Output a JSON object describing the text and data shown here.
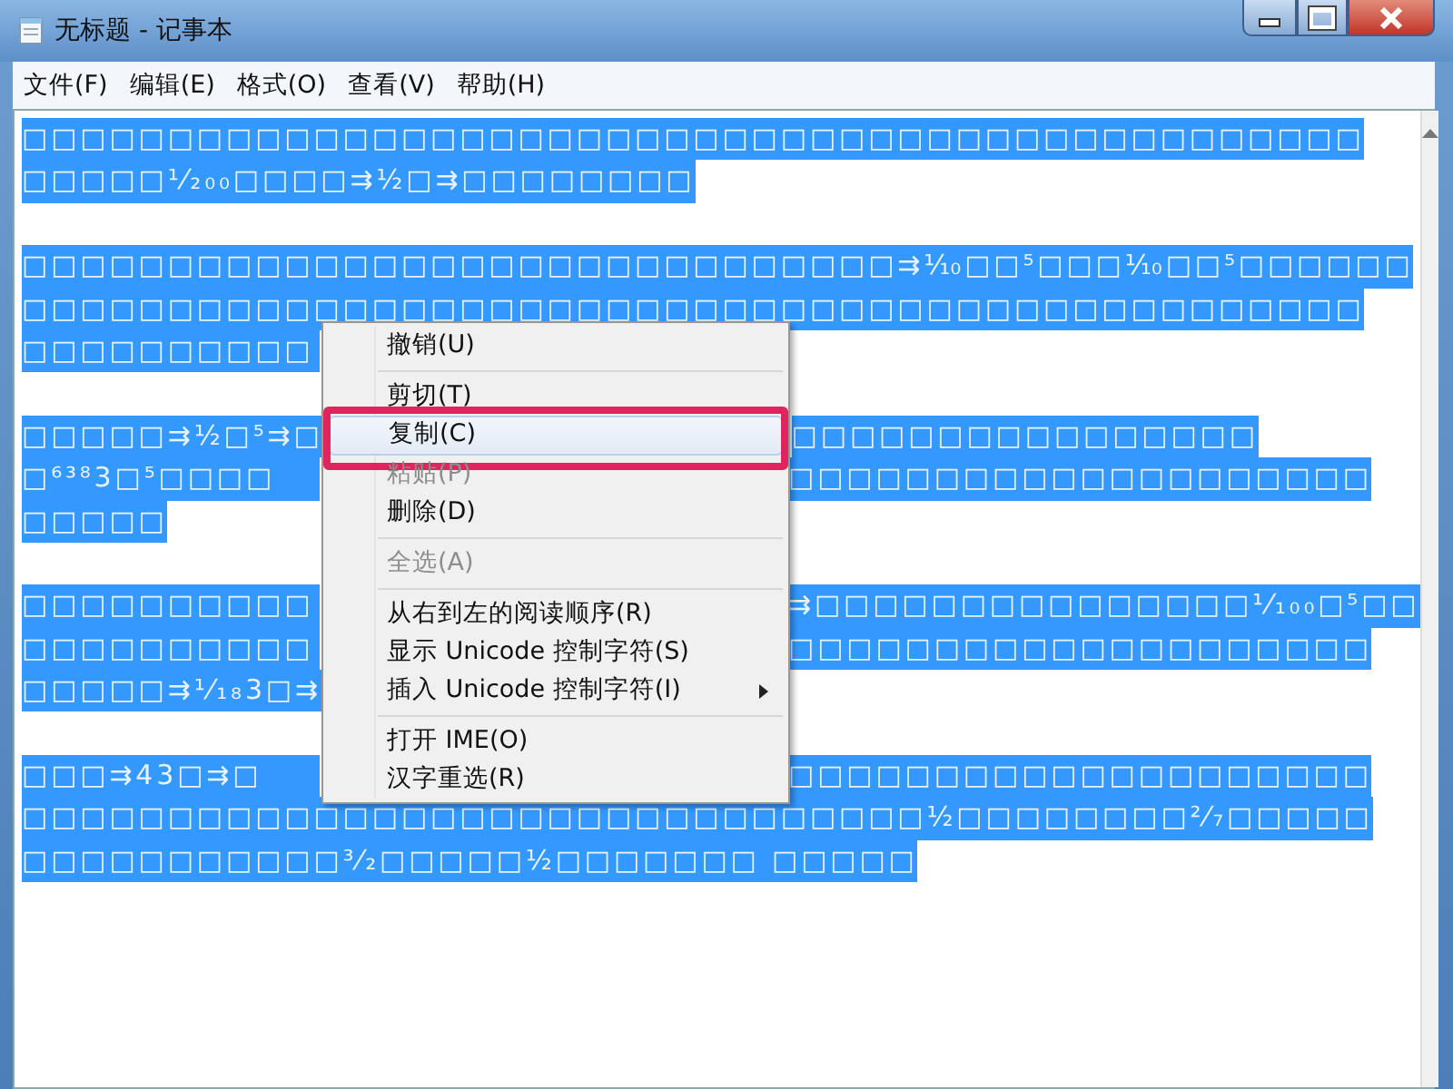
{
  "window": {
    "title": "无标题 - 记事本"
  },
  "menu_bar": [
    "文件(F)",
    "编辑(E)",
    "格式(O)",
    "查看(V)",
    "帮助(H)"
  ],
  "paragraphs": [
    {
      "lines": [
        {
          "text": "□□□□□□□□□□□□□□□□□□□□□□□□□□□□□□□□□□□□□□□□□□□□□□"
        },
        {
          "text": "□□□□□¹⁄₂₀₀□□□□⇉½□⇉□□□□□□□□"
        }
      ]
    },
    {
      "lines": [
        {
          "text": "□□□□□□□□□□□□□□□□□□□□□□□□□□□□□□⇉⅒□□⁵□□□⅒□□⁵□□□□□□"
        },
        {
          "text": "□□□□□□□□□□□□□□□□□□□□□□□□□□□□□□□□□□□□□□□□□□□□□□"
        },
        {
          "left": "□□□□□□□□□□"
        }
      ]
    },
    {
      "lines": [
        {
          "left": "□□□□□⇉½□⁵⇉□",
          "right": "□□□□□□□□□□□□□□□□"
        },
        {
          "left": "□⁶³⁸3□⁵□□□□",
          "right": "□□□□□□□□□□□□□□□□□□□□"
        },
        {
          "text": "□□□□□"
        }
      ]
    },
    {
      "lines": [
        {
          "left": "□□□□□□□□□□",
          "right": "⇉□□□□□□□□□□□□□□□¹⁄₁₀₀□⁵□□"
        },
        {
          "left": "□□□□□□□□□□",
          "right": "□□□□□□□□□□□□□□□□□□□□"
        },
        {
          "left": "□□□□□⇉¹⁄₁₈3□⇉"
        }
      ]
    },
    {
      "lines": [
        {
          "left": "□□□⇉43□⇉□",
          "right": "□□□□□□□□□□□□□□□□□□□□"
        },
        {
          "text": "□□□□□□□□□□□□□□□□□□□□□□□□□□□□□□□½□□□□□□□□²⁄₇□□□□□"
        },
        {
          "text": "□□□□□□□□□□□³⁄₂□□□□□½□□□□□□□ □□□□□"
        }
      ]
    }
  ],
  "context_menu": [
    {
      "kind": "item",
      "label": "撤销(U)",
      "disabled": false,
      "selected": false,
      "outlined": false,
      "submenu": false
    },
    {
      "kind": "separator"
    },
    {
      "kind": "item",
      "label": "剪切(T)",
      "disabled": false,
      "selected": false,
      "outlined": false,
      "submenu": false
    },
    {
      "kind": "item",
      "label": "复制(C)",
      "disabled": false,
      "selected": true,
      "outlined": true,
      "submenu": false
    },
    {
      "kind": "item",
      "label": "粘贴(P)",
      "disabled": true,
      "selected": false,
      "outlined": false,
      "submenu": false
    },
    {
      "kind": "item",
      "label": "删除(D)",
      "disabled": false,
      "selected": false,
      "outlined": false,
      "submenu": false
    },
    {
      "kind": "separator"
    },
    {
      "kind": "item",
      "label": "全选(A)",
      "disabled": true,
      "selected": false,
      "outlined": false,
      "submenu": false
    },
    {
      "kind": "separator"
    },
    {
      "kind": "item",
      "label": "从右到左的阅读顺序(R)",
      "disabled": false,
      "selected": false,
      "outlined": false,
      "submenu": false
    },
    {
      "kind": "item",
      "label": "显示 Unicode 控制字符(S)",
      "disabled": false,
      "selected": false,
      "outlined": false,
      "submenu": false
    },
    {
      "kind": "item",
      "label": "插入 Unicode 控制字符(I)",
      "disabled": false,
      "selected": false,
      "outlined": false,
      "submenu": true
    },
    {
      "kind": "separator"
    },
    {
      "kind": "item",
      "label": "打开 IME(O)",
      "disabled": false,
      "selected": false,
      "outlined": false,
      "submenu": false
    },
    {
      "kind": "item",
      "label": "汉字重选(R)",
      "disabled": false,
      "selected": false,
      "outlined": false,
      "submenu": false
    }
  ]
}
